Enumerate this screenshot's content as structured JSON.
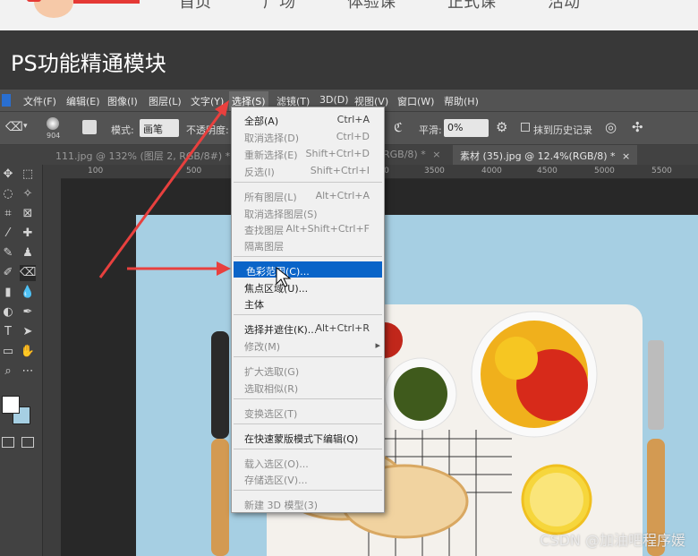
{
  "nav": {
    "links": [
      "首页",
      "广场",
      "体验课",
      "正式课",
      "活动"
    ]
  },
  "banner": {
    "title": "PS功能精通模块"
  },
  "menubar": {
    "items": [
      "文件(F)",
      "编辑(E)",
      "图像(I)",
      "图层(L)",
      "文字(Y)",
      "选择(S)",
      "滤镜(T)",
      "3D(D)",
      "视图(V)",
      "窗口(W)",
      "帮助(H)"
    ],
    "active": "选择(S)"
  },
  "options": {
    "brush_size": "904",
    "mode_label": "模式:",
    "mode_value": "画笔",
    "opacity_label": "不透明度:",
    "smoothing_label": "平滑:",
    "smoothing_value": "0%",
    "erase_history_label": "抹到历史记录"
  },
  "tabs": [
    {
      "label": "111.jpg @ 132% (图层 2, RGB/8#) *",
      "active": false
    },
    {
      "label": "RGB/8) *",
      "active": false
    },
    {
      "label": "素材 (35).jpg @ 12.4%(RGB/8) *",
      "active": true
    }
  ],
  "ruler": {
    "numbers": [
      "100",
      "500",
      "3000",
      "3500",
      "4000",
      "4500",
      "5000",
      "5500"
    ]
  },
  "select_menu": {
    "items": [
      {
        "label": "全部(A)",
        "shortcut": "Ctrl+A",
        "disabled": false
      },
      {
        "label": "取消选择(D)",
        "shortcut": "Ctrl+D",
        "disabled": true
      },
      {
        "label": "重新选择(E)",
        "shortcut": "Shift+Ctrl+D",
        "disabled": true
      },
      {
        "label": "反选(I)",
        "shortcut": "Shift+Ctrl+I",
        "disabled": true
      },
      {
        "label": "所有图层(L)",
        "shortcut": "Alt+Ctrl+A",
        "disabled": true
      },
      {
        "label": "取消选择图层(S)",
        "shortcut": "",
        "disabled": true
      },
      {
        "label": "查找图层",
        "shortcut": "Alt+Shift+Ctrl+F",
        "disabled": true
      },
      {
        "label": "隔离图层",
        "shortcut": "",
        "disabled": true
      },
      {
        "label": "色彩范围(C)...",
        "shortcut": "",
        "disabled": false,
        "highlighted": true
      },
      {
        "label": "焦点区域(U)...",
        "shortcut": "",
        "disabled": false
      },
      {
        "label": "主体",
        "shortcut": "",
        "disabled": false
      },
      {
        "label": "选择并遮住(K)...",
        "shortcut": "Alt+Ctrl+R",
        "disabled": false
      },
      {
        "label": "修改(M)",
        "shortcut": "",
        "disabled": true,
        "submenu": true
      },
      {
        "label": "扩大选取(G)",
        "shortcut": "",
        "disabled": true
      },
      {
        "label": "选取相似(R)",
        "shortcut": "",
        "disabled": true
      },
      {
        "label": "变换选区(T)",
        "shortcut": "",
        "disabled": true
      },
      {
        "label": "在快速蒙版模式下编辑(Q)",
        "shortcut": "",
        "disabled": false
      },
      {
        "label": "载入选区(O)...",
        "shortcut": "",
        "disabled": true
      },
      {
        "label": "存储选区(V)...",
        "shortcut": "",
        "disabled": true
      },
      {
        "label": "新建 3D 模型(3)",
        "shortcut": "",
        "disabled": true
      }
    ]
  },
  "colors": {
    "accent": "#0a64c8",
    "arrow": "#e8403e",
    "canvas_bg": "#a6cfe3"
  },
  "watermark": "CSDN @加油吧程序媛"
}
